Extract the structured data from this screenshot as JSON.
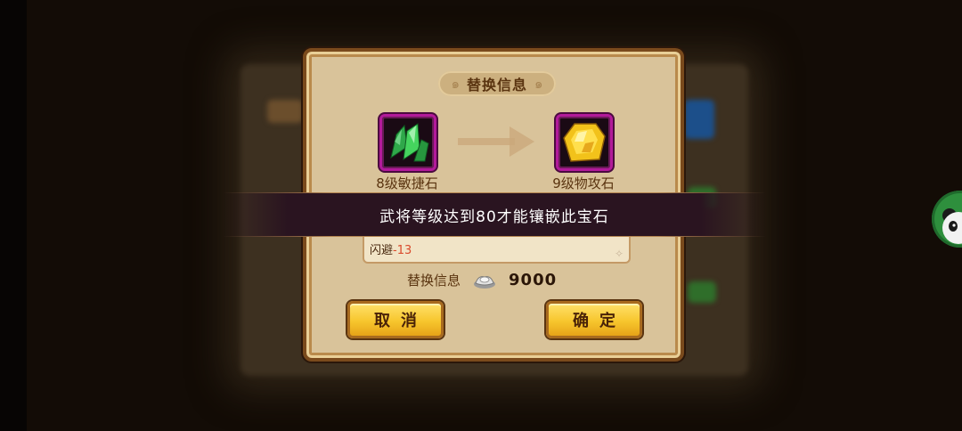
{
  "dialog": {
    "title": "替换信息",
    "from_gem": {
      "name": "8级敏捷石",
      "icon": "green-crystal-gem-icon",
      "color": "#3ccf5a"
    },
    "to_gem": {
      "name": "9级物攻石",
      "icon": "yellow-topaz-gem-icon",
      "color": "#f2c21a"
    },
    "stat": {
      "label": "闪避",
      "value": "-13"
    },
    "cost": {
      "label": "替换信息",
      "currency_icon": "silver-ingot-icon",
      "amount": "9000"
    },
    "cancel_label": "取消",
    "confirm_label": "确定"
  },
  "toast": {
    "message": "武将等级达到80才能镶嵌此宝石"
  },
  "side": {
    "avatar_icon": "panda-avatar-icon"
  },
  "colors": {
    "frame": "#7a4a1c",
    "parchment": "#d9c39a",
    "gem_border": "#b21a9a",
    "button": "#f7c62d"
  }
}
